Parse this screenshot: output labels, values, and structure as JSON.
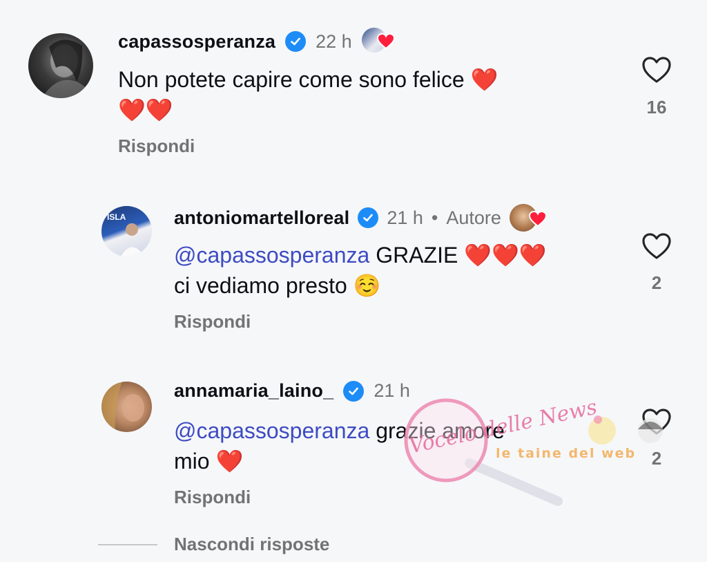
{
  "comments": [
    {
      "username": "capassosperanza",
      "time": "22 h",
      "text_line1": "Non potete capire come sono felice",
      "emoji_line1": "❤️",
      "text_line2_emoji": "❤️❤️",
      "reply_label": "Rispondi",
      "likes": "16"
    },
    {
      "username": "antoniomartelloreal",
      "time": "21 h",
      "separator": "•",
      "author_label": "Autore",
      "mention": "@capassosperanza",
      "text_line1": "GRAZIE",
      "emoji_line1": "❤️❤️❤️",
      "text_line2": "ci vediamo presto",
      "emoji_line2": "☺️",
      "reply_label": "Rispondi",
      "likes": "2"
    },
    {
      "username": "annamaria_laino_",
      "time": "21 h",
      "mention": "@capassosperanza",
      "text_line1": "grazie amore",
      "text_line2": "mio",
      "emoji_line2": "❤️",
      "reply_label": "Rispondi",
      "likes": "2"
    }
  ],
  "hide_replies_label": "Nascondi risposte",
  "watermarks": {
    "left": "Vocelo delle News",
    "right": "le taine del web"
  },
  "colors": {
    "verified": "#1d8cf7",
    "mention": "#3d4bc3",
    "muted": "#737373",
    "heart": "#e0202e"
  }
}
